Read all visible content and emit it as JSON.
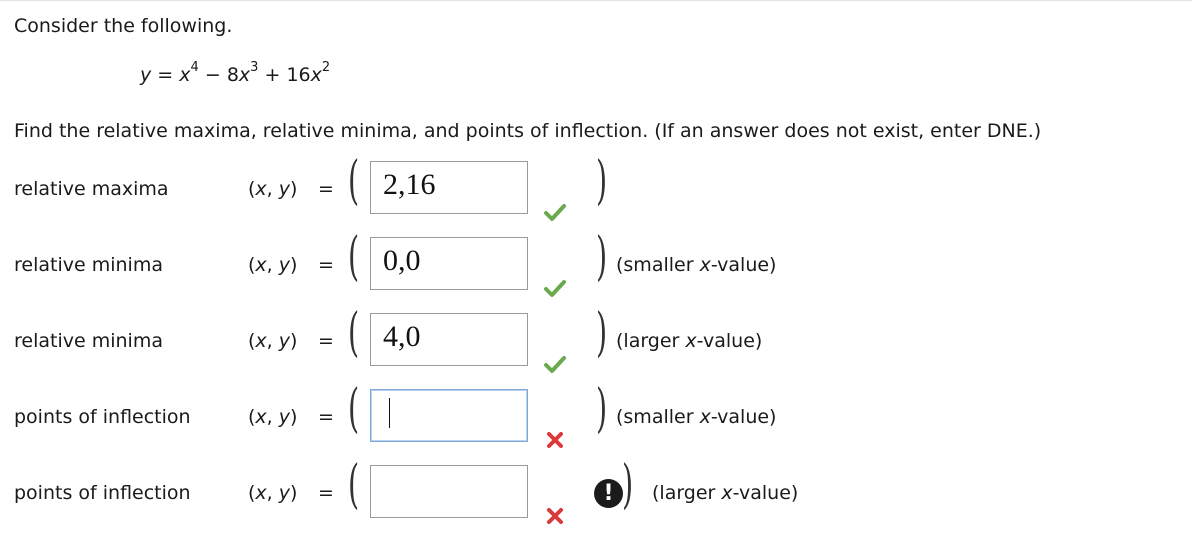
{
  "intro": "Consider the following.",
  "equation": {
    "lhs": "y",
    "eq": "=",
    "t1_base": "x",
    "t1_exp": "4",
    "op1": "−",
    "t2_coef": "8",
    "t2_base": "x",
    "t2_exp": "3",
    "op2": "+",
    "t3_coef": "16",
    "t3_base": "x",
    "t3_exp": "2"
  },
  "instructions": "Find the relative maxima, relative minima, and points of inflection. (If an answer does not exist, enter DNE.)",
  "coord_label_x": "x",
  "coord_label_y": "y",
  "equals": "=",
  "rows": [
    {
      "label": "relative maxima",
      "value": "2,16",
      "status": "correct",
      "hint_pre": "",
      "hint_var": "",
      "hint_post": ""
    },
    {
      "label": "relative minima",
      "value": "0,0",
      "status": "correct",
      "hint_pre": "(smaller ",
      "hint_var": "x",
      "hint_post": "-value)"
    },
    {
      "label": "relative minima",
      "value": "4,0",
      "status": "correct",
      "hint_pre": "(larger ",
      "hint_var": "x",
      "hint_post": "-value)"
    },
    {
      "label": "points of inflection",
      "value": "",
      "status": "incorrect",
      "hint_pre": "(smaller ",
      "hint_var": "x",
      "hint_post": "-value)"
    },
    {
      "label": "points of inflection",
      "value": "",
      "status": "incorrect",
      "hint_pre": "(larger ",
      "hint_var": "x",
      "hint_post": "-value)"
    }
  ],
  "alert_glyph": "!",
  "colors": {
    "correct": "#6aaa4f",
    "incorrect": "#d93a3a",
    "focus": "#7fa7d8"
  }
}
